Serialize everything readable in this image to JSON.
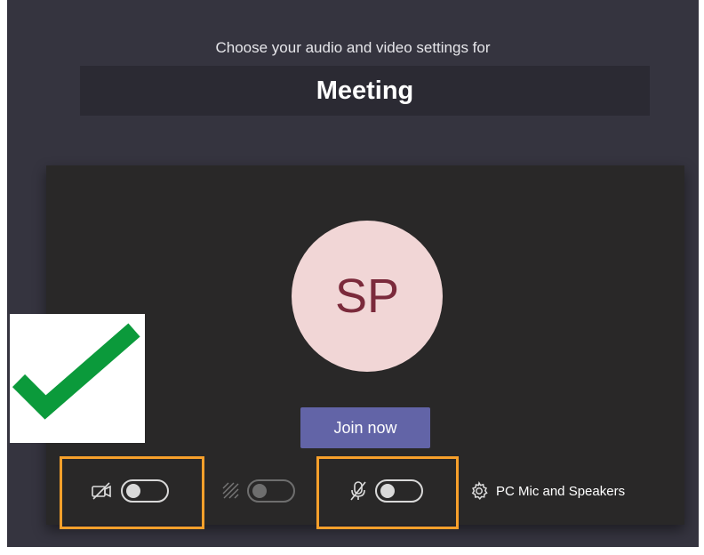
{
  "header": {
    "subtitle": "Choose your audio and video settings for",
    "title": "Meeting"
  },
  "avatar": {
    "initials": "SP"
  },
  "join_button": {
    "label": "Join now"
  },
  "controls": {
    "camera_toggle": {
      "icon": "camera-off-icon",
      "state": "off"
    },
    "background_toggle": {
      "icon": "background-blur-icon",
      "state": "off",
      "enabled": false
    },
    "mic_toggle": {
      "icon": "mic-off-icon",
      "state": "off"
    },
    "device_settings": {
      "icon": "gear-icon",
      "label": "PC Mic and Speakers"
    }
  },
  "annotation": {
    "checkmark_color": "#0b9a3b",
    "highlight_color": "#f7a02b"
  },
  "colors": {
    "background": "#35343f",
    "preview": "#292828",
    "accent": "#6264a7",
    "avatar_bg": "#f1d6d6",
    "avatar_text": "#7b2a3b"
  }
}
